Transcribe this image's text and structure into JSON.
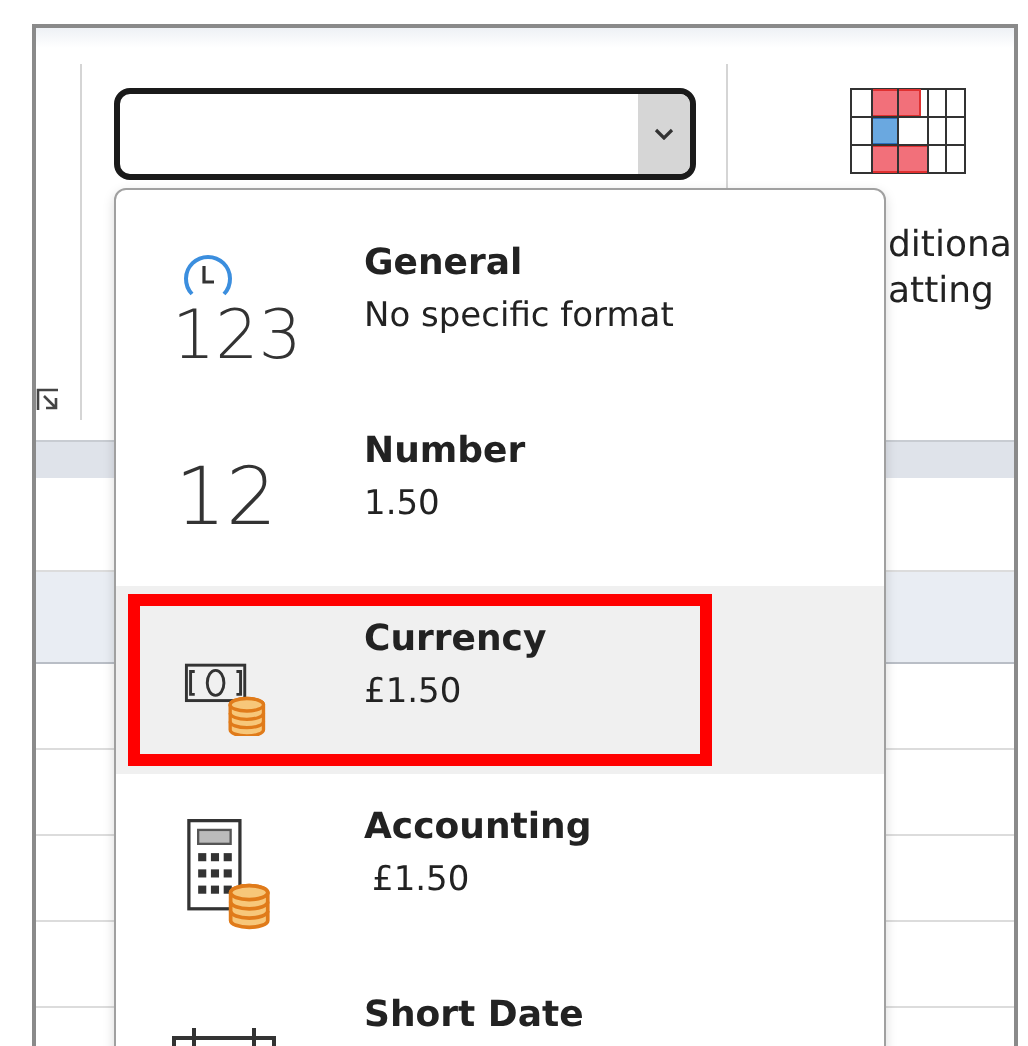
{
  "number_format_box": {
    "expanded": true
  },
  "ribbon_label": [
    "ditiona",
    "atting"
  ],
  "menu": [
    {
      "kind": "general",
      "icon_text": "123",
      "title": "General",
      "subtitle": "No specific format",
      "selected": false,
      "annotated": false
    },
    {
      "kind": "number",
      "icon_text": "12",
      "title": "Number",
      "subtitle": "1.50",
      "selected": false,
      "annotated": false
    },
    {
      "kind": "currency",
      "title": "Currency",
      "subtitle": "£1.50",
      "selected": true,
      "annotated": true
    },
    {
      "kind": "accounting",
      "title": "Accounting",
      "subtitle": "£1.50",
      "selected": false,
      "annotated": false
    },
    {
      "kind": "date",
      "title": "Short Date",
      "selected": false,
      "annotated": false
    }
  ]
}
